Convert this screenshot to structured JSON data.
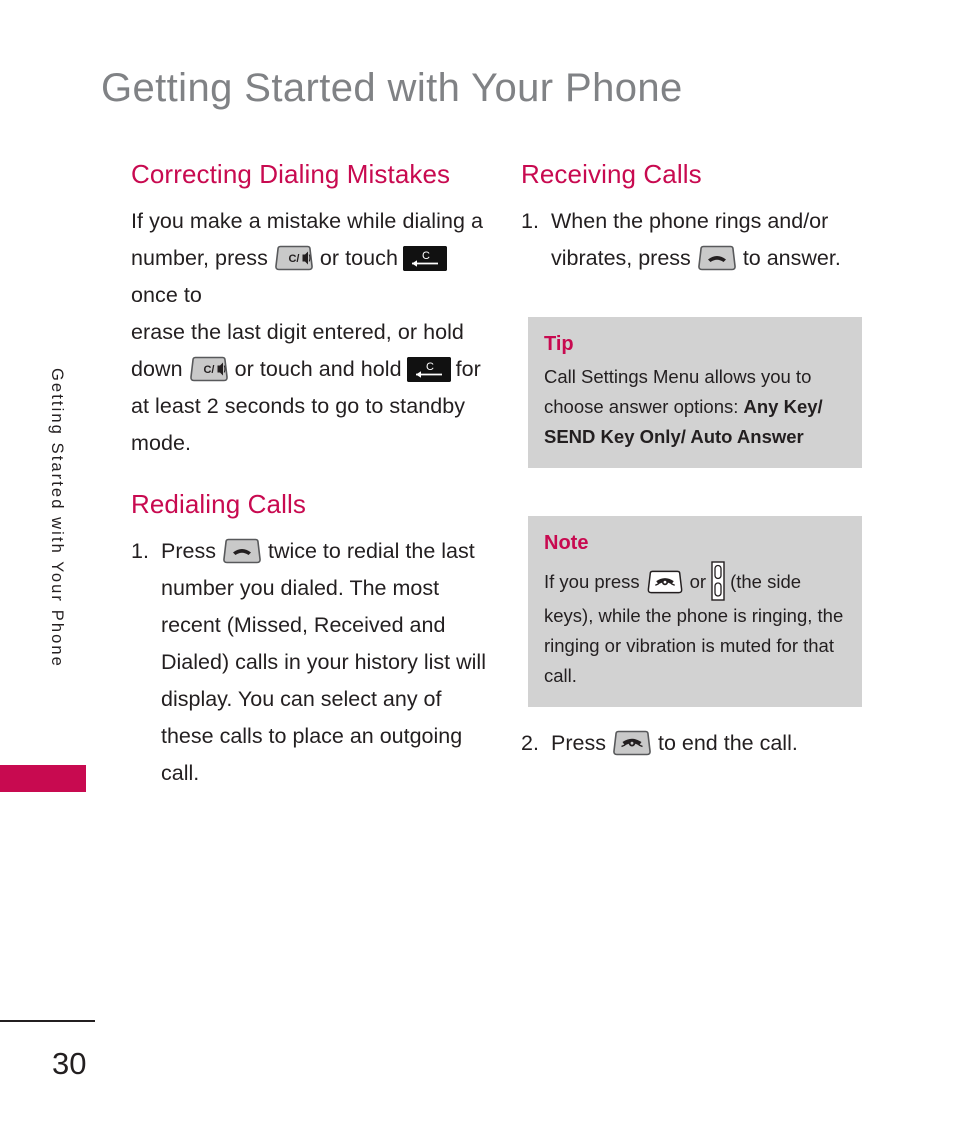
{
  "page": {
    "title": "Getting Started with Your Phone",
    "number": "30",
    "side_tab_text": "Getting Started with Your Phone",
    "accent_color": "#c80a50",
    "title_color": "#808285",
    "callout_bg": "#d2d2d2"
  },
  "left_column": {
    "section1": {
      "heading": "Correcting Dialing Mistakes",
      "text_part1": "If you make a mistake while dialing a number, press",
      "text_part2": "or touch",
      "text_part3": "once to",
      "text_part4": "erase the last digit entered, or hold down",
      "text_part5": "or touch and hold",
      "text_part6": "for at least 2 seconds to go to standby mode."
    },
    "section2": {
      "heading": "Redialing Calls",
      "item1_number": "1.",
      "item1_part1": "Press",
      "item1_part2": "twice to redial the last number you dialed. The most recent (Missed, Received and Dialed) calls in your history list will display. You can select any of these calls to place an outgoing call."
    }
  },
  "right_column": {
    "section1": {
      "heading": "Receiving Calls",
      "item1_number": "1.",
      "item1_part1": "When the phone rings and/or vibrates, press",
      "item1_part2": "to answer.",
      "item2_number": "2.",
      "item2_part1": "Press",
      "item2_part2": "to end the call."
    },
    "tip": {
      "title": "Tip",
      "body_part1": "Call Settings Menu allows you to choose answer options:",
      "body_bold": "Any Key/ SEND Key Only/ Auto Answer"
    },
    "note": {
      "title": "Note",
      "body_part1": "If you press",
      "body_part2": "or",
      "body_part3": "(the side keys), while the phone is ringing, the ringing or vibration is muted for that call."
    }
  },
  "icons": {
    "clear_key": "clear-speaker-key-icon",
    "touch_clear_key": "touch-clear-backspace-key-icon",
    "send_key": "send-key-icon",
    "end_key": "end-key-icon",
    "side_keys": "side-keys-icon"
  }
}
